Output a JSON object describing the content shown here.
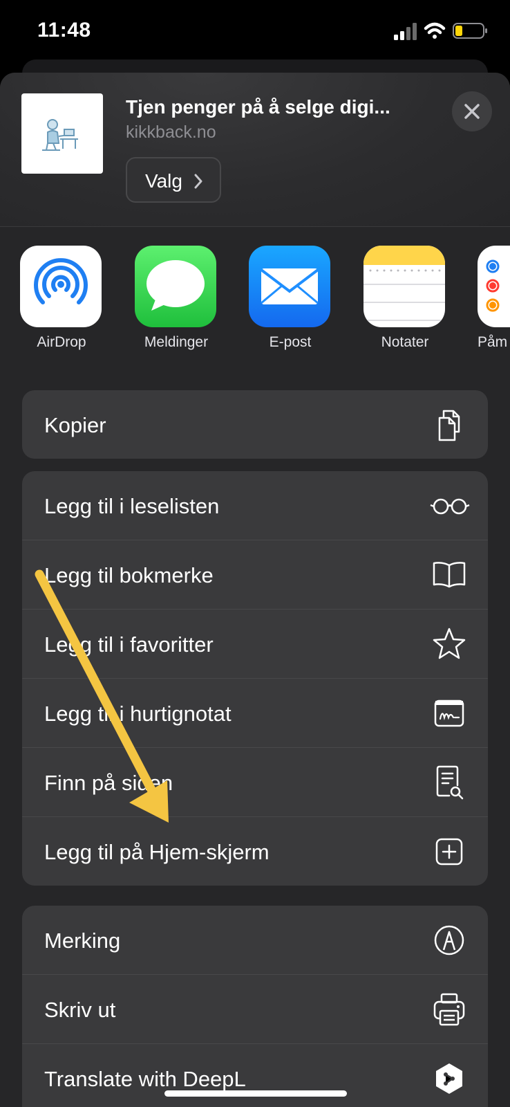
{
  "status_bar": {
    "time": "11:48"
  },
  "header": {
    "title": "Tjen penger på å selge digi...",
    "domain": "kikkback.no",
    "options_label": "Valg"
  },
  "apps": [
    {
      "label": "AirDrop",
      "icon": "airdrop-icon"
    },
    {
      "label": "Meldinger",
      "icon": "messages-icon"
    },
    {
      "label": "E-post",
      "icon": "mail-icon"
    },
    {
      "label": "Notater",
      "icon": "notes-icon"
    },
    {
      "label": "Påm",
      "icon": "reminders-icon"
    }
  ],
  "actions": {
    "copy": {
      "label": "Kopier",
      "icon": "copy-icon"
    },
    "group2": [
      {
        "label": "Legg til i leselisten",
        "icon": "glasses-icon"
      },
      {
        "label": "Legg til bokmerke",
        "icon": "book-icon"
      },
      {
        "label": "Legg til i favoritter",
        "icon": "star-icon"
      },
      {
        "label": "Legg til i hurtignotat",
        "icon": "quick-note-icon"
      },
      {
        "label": "Finn på siden",
        "icon": "find-on-page-icon"
      },
      {
        "label": "Legg til på Hjem-skjerm",
        "icon": "add-square-icon"
      }
    ],
    "group3": [
      {
        "label": "Merking",
        "icon": "markup-icon"
      },
      {
        "label": "Skriv ut",
        "icon": "printer-icon"
      },
      {
        "label": "Translate with DeepL",
        "icon": "deepl-icon"
      }
    ]
  },
  "colors": {
    "sheet_background": "#262628",
    "row_background": "#3a3a3c",
    "annotation_arrow": "#f4c542",
    "messages_green": "#34c759",
    "mail_blue": "#1f8fff",
    "notes_yellow": "#ffd54a"
  }
}
